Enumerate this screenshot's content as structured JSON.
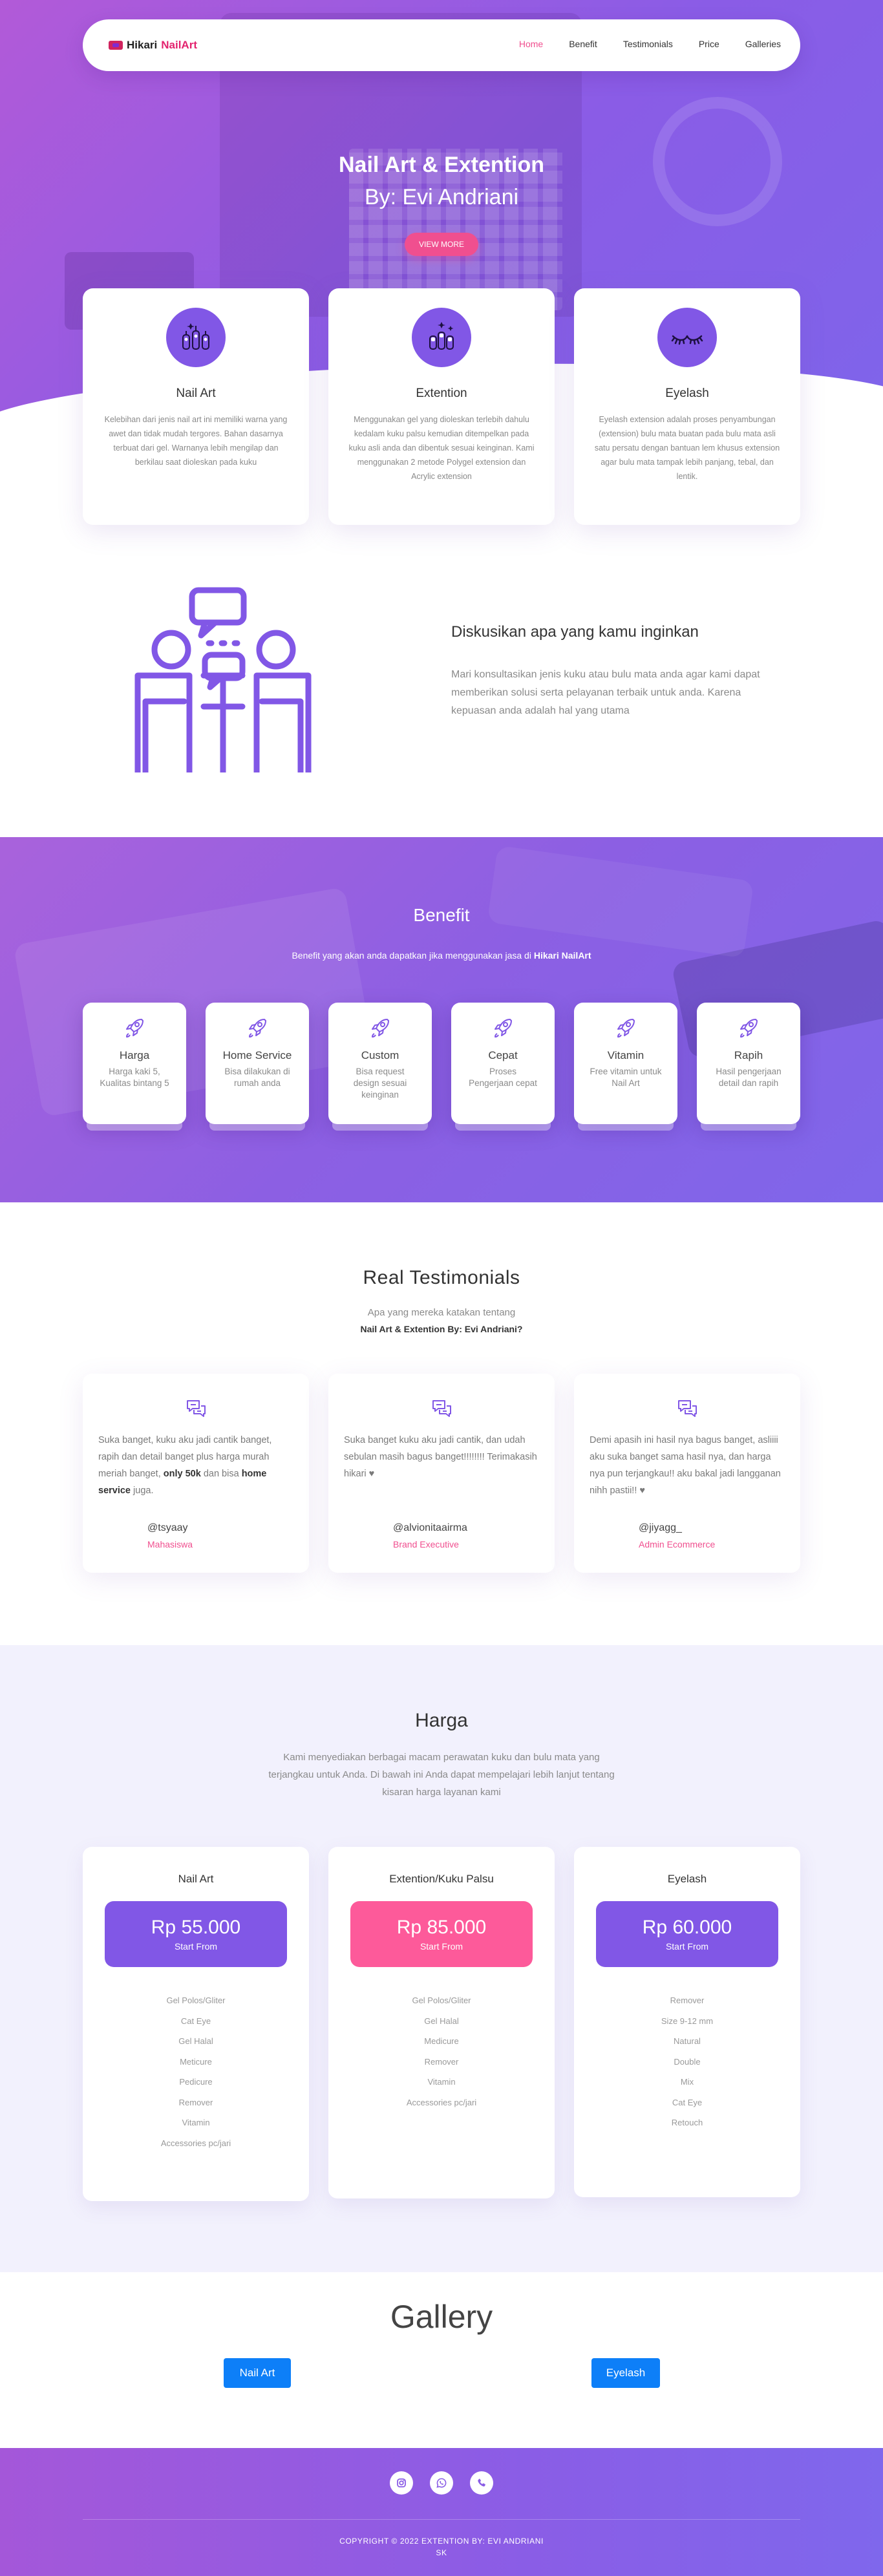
{
  "nav": {
    "logo_part1": "Hikari",
    "logo_part2": "NailArt",
    "items": [
      "Home",
      "Benefit",
      "Testimonials",
      "Price",
      "Galleries"
    ]
  },
  "hero": {
    "title": "Nail Art & Extention",
    "subtitle": "By: Evi Andriani",
    "button": "VIEW MORE"
  },
  "services": [
    {
      "title": "Nail Art",
      "icon": "nail-art-icon",
      "desc": "Kelebihan dari jenis nail art ini memiliki warna yang awet dan tidak mudah tergores. Bahan dasarnya terbuat dari gel. Warnanya lebih mengilap dan berkilau saat dioleskan pada kuku"
    },
    {
      "title": "Extention",
      "icon": "extension-icon",
      "desc": "Menggunakan gel yang dioleskan terlebih dahulu kedalam kuku palsu kemudian ditempelkan pada kuku asli anda dan dibentuk sesuai keinginan. Kami menggunakan 2 metode Polygel extension dan Acrylic extension"
    },
    {
      "title": "Eyelash",
      "icon": "eyelash-icon",
      "desc": "Eyelash extension adalah proses penyambungan (extension) bulu mata buatan pada bulu mata asli satu persatu dengan bantuan lem khusus extension agar bulu mata tampak lebih panjang, tebal, dan lentik."
    }
  ],
  "discuss": {
    "title": "Diskusikan apa yang kamu inginkan",
    "text": "Mari konsultasikan jenis kuku atau bulu mata anda agar kami dapat memberikan solusi serta pelayanan terbaik untuk anda. Karena kepuasan anda adalah hal yang utama"
  },
  "benefit": {
    "title": "Benefit",
    "subtitle_pre": "Benefit yang akan anda dapatkan jika menggunakan jasa di",
    "subtitle_brand": "Hikari NailArt",
    "items": [
      {
        "title": "Harga",
        "desc": "Harga kaki 5, Kualitas bintang 5"
      },
      {
        "title": "Home Service",
        "desc": "Bisa dilakukan di rumah anda"
      },
      {
        "title": "Custom",
        "desc": "Bisa request design sesuai keinginan"
      },
      {
        "title": "Cepat",
        "desc": "Proses Pengerjaan cepat"
      },
      {
        "title": "Vitamin",
        "desc": "Free vitamin untuk Nail Art"
      },
      {
        "title": "Rapih",
        "desc": "Hasil pengerjaan detail dan rapih"
      }
    ]
  },
  "testimonials": {
    "title": "Real Testimonials",
    "subtitle1": "Apa yang mereka katakan tentang",
    "subtitle2": "Nail Art & Extention By: Evi Andriani?",
    "items": [
      {
        "text_pre": "Suka banget, kuku aku jadi cantik banget, rapih dan detail banget plus harga murah meriah banget,",
        "text_bold1": "only 50k",
        "text_mid": "dan bisa",
        "text_bold2": "home service",
        "text_post": "juga.",
        "name": "@tsyaay",
        "role": "Mahasiswa"
      },
      {
        "text": "Suka banget kuku aku jadi cantik, dan udah sebulan masih bagus banget!!!!!!!! Terimakasih hikari ♥",
        "name": "@alvionitaairma",
        "role": "Brand Executive"
      },
      {
        "text": "Demi apasih ini hasil nya bagus banget, asliiii aku suka banget sama hasil nya, dan harga nya pun terjangkau!! aku bakal jadi langganan nihh pastii!! ♥",
        "name": "@jiyagg_",
        "role": "Admin Ecommerce"
      }
    ]
  },
  "pricing": {
    "title": "Harga",
    "subtitle": "Kami menyediakan berbagai macam perawatan kuku dan bulu mata yang terjangkau untuk Anda. Di bawah ini Anda dapat mempelajari lebih lanjut tentang kisaran harga layanan kami",
    "plans": [
      {
        "name": "Nail Art",
        "price": "Rp 55.000",
        "from": "Start From",
        "color": "#8157e6",
        "features": [
          "Gel Polos/Gliter",
          "Cat Eye",
          "Gel Halal",
          "Meticure",
          "Pedicure",
          "Remover",
          "Vitamin",
          "Accessories pc/jari"
        ]
      },
      {
        "name": "Extention/Kuku Palsu",
        "price": "Rp 85.000",
        "from": "Start From",
        "color": "#fd5a9a",
        "features": [
          "Gel Polos/Gliter",
          "Gel Halal",
          "Medicure",
          "Remover",
          "Vitamin",
          "Accessories pc/jari"
        ]
      },
      {
        "name": "Eyelash",
        "price": "Rp 60.000",
        "from": "Start From",
        "color": "#8157e6",
        "features": [
          "Remover",
          "Size 9-12 mm",
          "Natural",
          "Double",
          "Mix",
          "Cat Eye",
          "Retouch"
        ]
      }
    ]
  },
  "gallery": {
    "title": "Gallery",
    "buttons": [
      "Nail Art",
      "Eyelash"
    ]
  },
  "footer": {
    "social": [
      "instagram-icon",
      "whatsapp-icon",
      "phone-icon"
    ],
    "copyright1": "COPYRIGHT © 2022 EXTENTION BY: EVI ANDRIANI",
    "copyright2": "SK"
  },
  "colors": {
    "accent_purple": "#8157e6",
    "accent_pink": "#f04f8f",
    "gallery_button": "#0d7ff8"
  }
}
